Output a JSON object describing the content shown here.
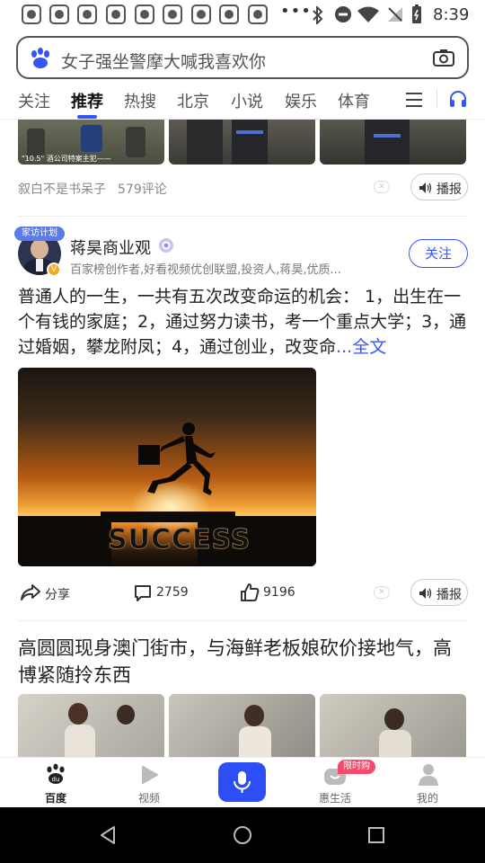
{
  "status_bar": {
    "time": "8:39",
    "dots": "•••"
  },
  "search": {
    "placeholder": "女子强坐警摩大喊我喜欢你"
  },
  "tabs": [
    {
      "label": "关注"
    },
    {
      "label": "推荐"
    },
    {
      "label": "热搜"
    },
    {
      "label": "北京"
    },
    {
      "label": "小说"
    },
    {
      "label": "娱乐"
    },
    {
      "label": "体育"
    }
  ],
  "news1": {
    "image_caption": "\"10.5\" 酒公司特案主犯——",
    "source": "叙白不是书呆子",
    "comments": "579评论",
    "broadcast": "播报"
  },
  "post": {
    "author": "蒋昊商业观",
    "badge": "家访计划",
    "desc": "百家榜创作者,好看视频优创联盟,投资人,蒋昊,优质...",
    "follow": "关注",
    "text": "普通人的一生，一共有五次改变命运的机会： 1，出生在一个有钱的家庭；2，通过努力读书，考一个重点大学；3，通过婚姻，攀龙附凤；4，通过创业，改变命",
    "more": "...全文",
    "image_word": "SUCCESS",
    "share": "分享",
    "comments": "2759",
    "likes": "9196",
    "broadcast": "播报"
  },
  "news2": {
    "title": "高圆圆现身澳门街市，与海鲜老板娘砍价接地气，高博紧随拎东西"
  },
  "bottom_nav": [
    {
      "label": "百度"
    },
    {
      "label": "视频"
    },
    {
      "label": ""
    },
    {
      "label": "惠生活",
      "badge": "限时购"
    },
    {
      "label": "我的"
    }
  ],
  "colors": {
    "accent": "#3655f5",
    "nav_active": "#2d4ef5"
  }
}
